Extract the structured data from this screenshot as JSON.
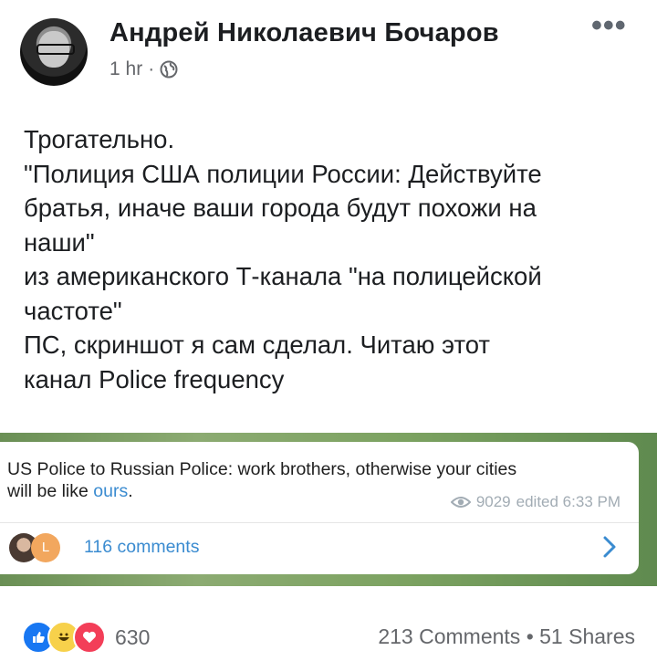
{
  "author": {
    "name": "Андрей Николаевич Бочаров",
    "time": "1 hr",
    "separator": "·",
    "audience_icon": "globe-icon"
  },
  "menu": {
    "more_label": "•••"
  },
  "post": {
    "lines": [
      "Трогательно.",
      "\"Полиция США полиции России:  Действуйте",
      "братья, иначе ваши города будут похожи на",
      "наши\"",
      "из американского Т-канала \"на полицейской",
      "частоте\"",
      "ПС, скриншот я сам сделал. Читаю этот",
      "канал Police frequency"
    ]
  },
  "screenshot": {
    "message_line1": "US Police to Russian Police: work brothers, otherwise your cities",
    "message_line2_prefix": "will be like ",
    "message_link": "ours",
    "message_line2_suffix": ".",
    "views": "9029",
    "edited": "edited 6:33 PM",
    "comments_avatar_letter": "L",
    "comments_label": "116 comments",
    "link_color": "#3a8bd0"
  },
  "footer": {
    "reaction_icons": [
      "like-icon",
      "haha-icon",
      "love-icon"
    ],
    "reaction_count": "630",
    "comments": "213 Comments",
    "dot": "•",
    "shares": "51 Shares"
  }
}
